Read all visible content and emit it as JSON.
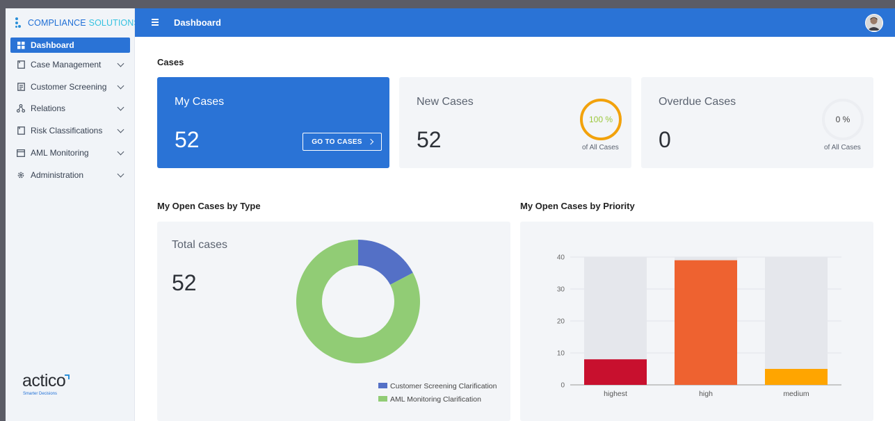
{
  "brand": {
    "name_a": "COMPLIANCE",
    "name_b": "SOLUTIONS"
  },
  "sidebar": {
    "items": [
      {
        "label": "Dashboard",
        "icon": "grid-icon"
      },
      {
        "label": "Case Management",
        "icon": "document-icon"
      },
      {
        "label": "Customer Screening",
        "icon": "list-document-icon"
      },
      {
        "label": "Relations",
        "icon": "network-icon"
      },
      {
        "label": "Risk Classifications",
        "icon": "document-icon"
      },
      {
        "label": "AML Monitoring",
        "icon": "monitor-icon"
      },
      {
        "label": "Administration",
        "icon": "gear-icon"
      }
    ],
    "logo": {
      "word": "actico",
      "tagline": "Smarter Decisions"
    }
  },
  "topbar": {
    "title": "Dashboard"
  },
  "main": {
    "cases_title": "Cases",
    "cards": {
      "my_cases": {
        "title": "My Cases",
        "value": "52",
        "button": "GO TO CASES"
      },
      "new_cases": {
        "title": "New Cases",
        "value": "52",
        "percent_label": "100 %",
        "percent": 100,
        "sub": "of All Cases"
      },
      "overdue_cases": {
        "title": "Overdue Cases",
        "value": "0",
        "percent_label": "0 %",
        "percent": 0,
        "sub": "of All Cases"
      }
    },
    "by_type": {
      "title": "My Open Cases by Type",
      "total_label": "Total cases",
      "total_value": "52"
    },
    "by_priority": {
      "title": "My Open Cases by Priority"
    }
  },
  "colors": {
    "accent": "#2a73d6",
    "ring_full": "#f2a20c",
    "donut_screening": "#5470c6",
    "donut_aml": "#91cc75",
    "bar_highest": "#c8102e",
    "bar_high": "#ee6230",
    "bar_medium": "#ffa500",
    "bar_background": "#e5e7ec"
  },
  "chart_data": [
    {
      "type": "pie",
      "variant": "donut",
      "series": [
        {
          "name": "Customer Screening Clarification",
          "value": 9
        },
        {
          "name": "AML Monitoring Clarification",
          "value": 43
        }
      ],
      "legend": "bottom-right"
    },
    {
      "type": "bar",
      "categories": [
        "highest",
        "high",
        "medium"
      ],
      "values": [
        8,
        39,
        5
      ],
      "background_max": 40,
      "ylim": [
        0,
        40
      ],
      "yticks": [
        0,
        10,
        20,
        30,
        40
      ],
      "grid": true
    }
  ]
}
